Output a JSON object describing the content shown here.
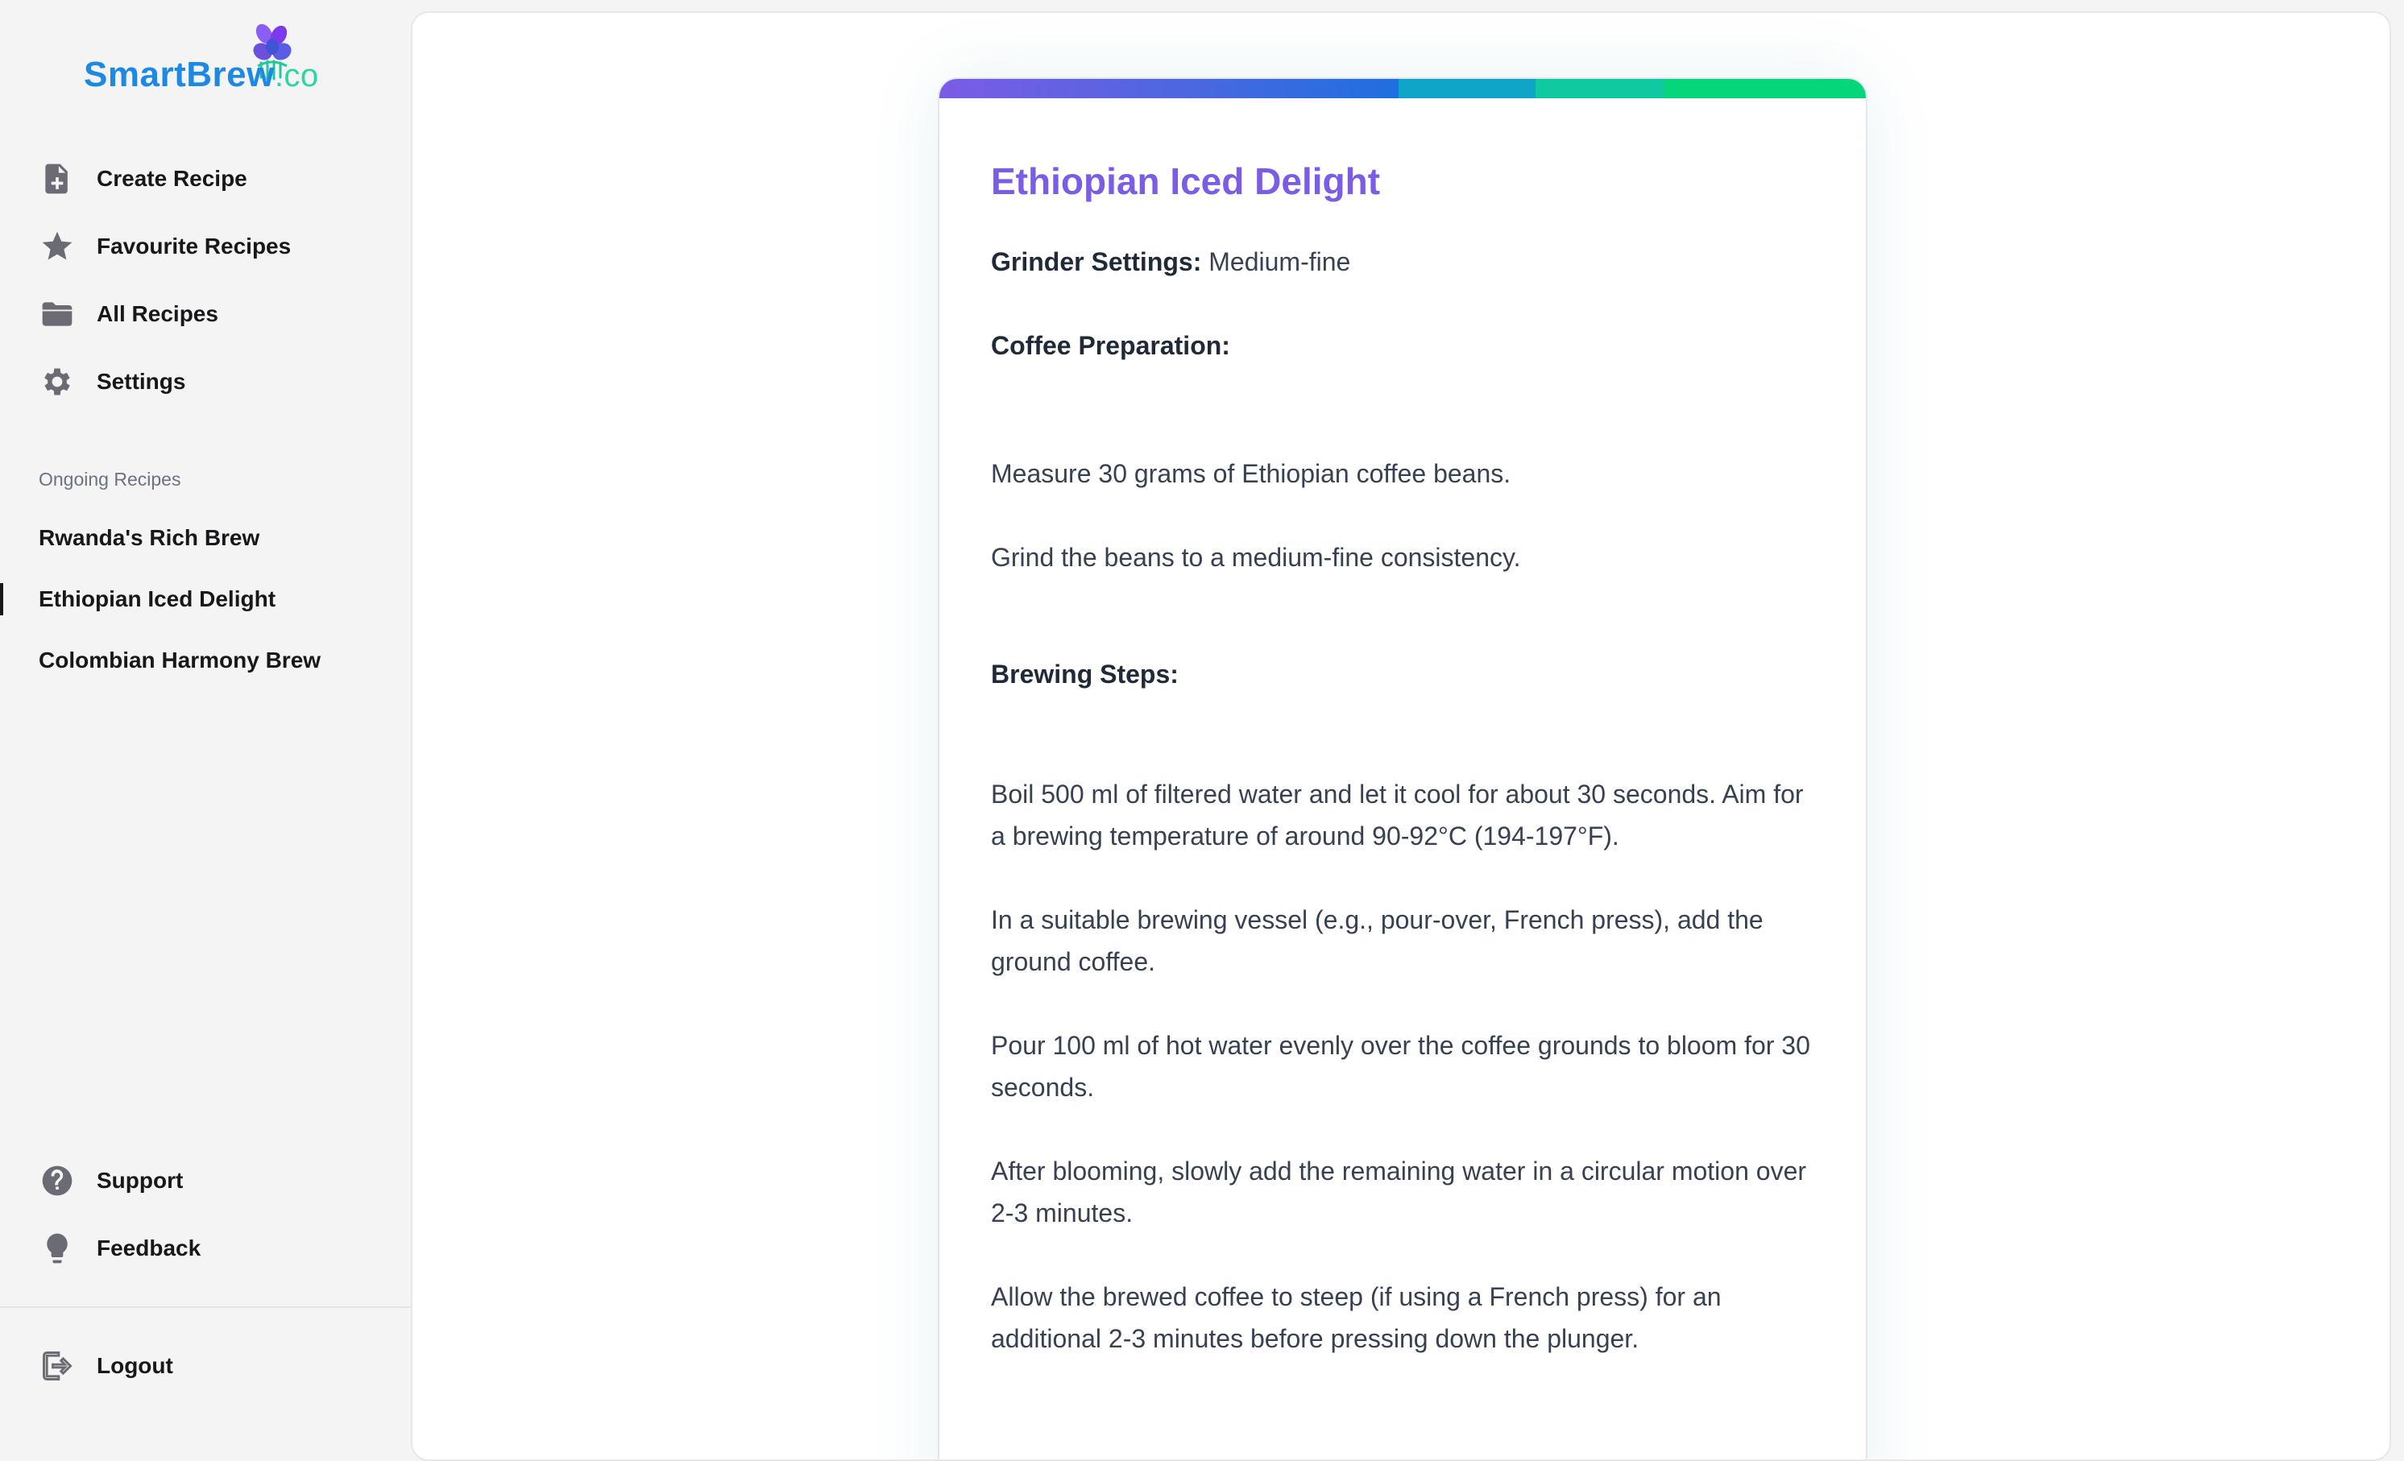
{
  "brand": {
    "name_smart": "SmartBrew",
    "name_suffix": ".co",
    "logo_icon": "coffee-bean-plant-icon",
    "colors": {
      "smart": "#1e88e5",
      "brew": "#12b59b",
      "suffix": "#2dd4a4"
    }
  },
  "nav": {
    "items": [
      {
        "label": "Create Recipe",
        "icon": "file-plus-icon"
      },
      {
        "label": "Favourite Recipes",
        "icon": "star-icon"
      },
      {
        "label": "All Recipes",
        "icon": "folder-icon"
      },
      {
        "label": "Settings",
        "icon": "gear-icon"
      }
    ]
  },
  "ongoing": {
    "title": "Ongoing Recipes",
    "items": [
      {
        "label": "Rwanda's Rich Brew",
        "active": false
      },
      {
        "label": "Ethiopian Iced Delight",
        "active": true
      },
      {
        "label": "Colombian Harmony Brew",
        "active": false
      }
    ]
  },
  "bottom_nav": {
    "items": [
      {
        "label": "Support",
        "icon": "question-circle-icon"
      },
      {
        "label": "Feedback",
        "icon": "lightbulb-icon"
      }
    ],
    "logout": {
      "label": "Logout",
      "icon": "logout-icon"
    }
  },
  "recipe": {
    "title": "Ethiopian Iced Delight",
    "title_color": "#7b5ce6",
    "accent_gradient": [
      "#7b5ce6",
      "#1e6fe0",
      "#0ea5c9",
      "#10c9a0",
      "#06d67a"
    ],
    "grinder_label": "Grinder Settings:",
    "grinder_value": "Medium-fine",
    "prep_heading": "Coffee Preparation:",
    "prep_steps": [
      "Measure 30 grams of Ethiopian coffee beans.",
      "Grind the beans to a medium-fine consistency."
    ],
    "brew_heading": "Brewing Steps:",
    "brew_steps": [
      "Boil 500 ml of filtered water and let it cool for about 30 seconds. Aim for a brewing temperature of around 90-92°C (194-197°F).",
      "In a suitable brewing vessel (e.g., pour-over, French press), add the ground coffee.",
      "Pour 100 ml of hot water evenly over the coffee grounds to bloom for 30 seconds.",
      "After blooming, slowly add the remaining water in a circular motion over 2-3 minutes.",
      "Allow the brewed coffee to steep (if using a French press) for an additional 2-3 minutes before pressing down the plunger."
    ]
  }
}
